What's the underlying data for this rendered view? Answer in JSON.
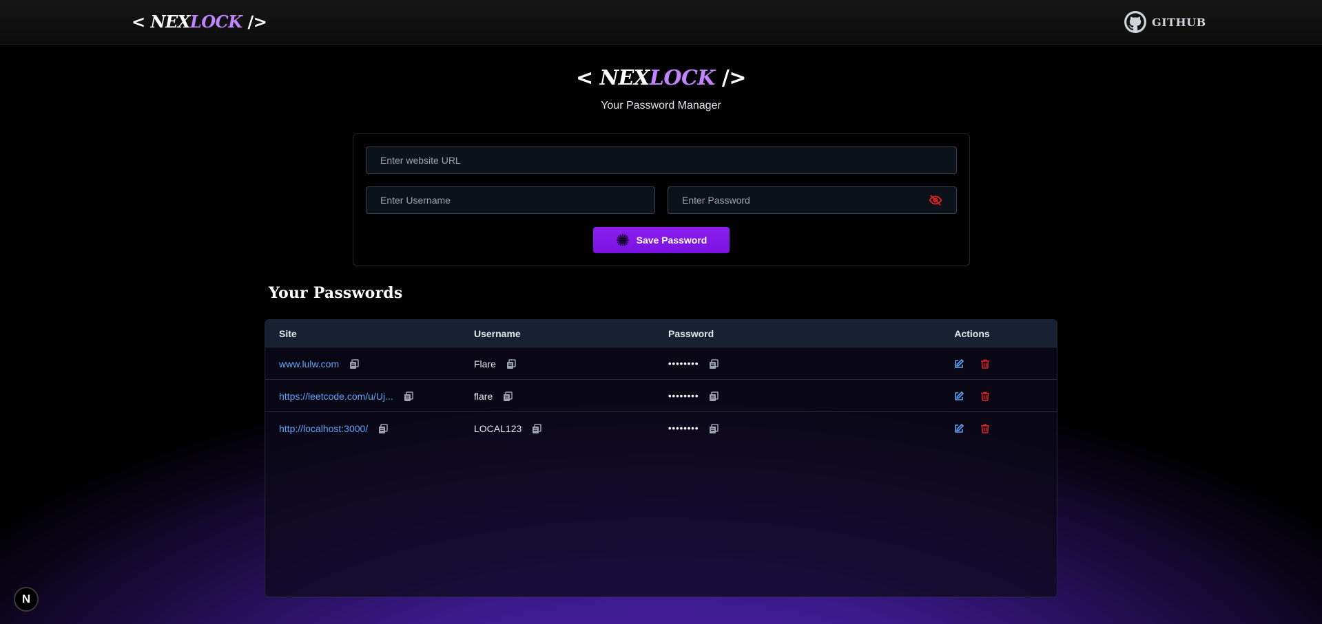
{
  "navbar": {
    "logo": {
      "open": "<",
      "part1": "NEX",
      "part2": "LOCK",
      "close": "/>"
    },
    "github_label": "GITHUB"
  },
  "header": {
    "logo": {
      "open": "<",
      "part1": "NEX",
      "part2": "LOCK",
      "close": "/>"
    },
    "subtitle": "Your Password Manager"
  },
  "form": {
    "url_placeholder": "Enter website URL",
    "url_value": "",
    "username_placeholder": "Enter Username",
    "username_value": "",
    "password_placeholder": "Enter Password",
    "password_value": "",
    "save_label": "Save Password"
  },
  "passwords": {
    "title": "Your Passwords",
    "columns": [
      "Site",
      "Username",
      "Password",
      "Actions"
    ],
    "rows": [
      {
        "site": "www.lulw.com",
        "username": "Flare",
        "password": "••••••••"
      },
      {
        "site": "https://leetcode.com/u/Uj...",
        "username": "flare",
        "password": "••••••••"
      },
      {
        "site": "http://localhost:3000/",
        "username": "LOCAL123",
        "password": "••••••••"
      }
    ]
  },
  "dev_badge": {
    "label": "N"
  },
  "colors": {
    "accent": "#7e22ce",
    "logo_accent": "#c084fc",
    "link": "#60a5fa",
    "edit_icon": "#60a5fa",
    "delete_icon": "#dc2626",
    "eye_icon": "#dc2626"
  },
  "icons": {
    "github": "github-icon",
    "eye_toggle": "eye-slash-icon",
    "save": "save-spark-icon",
    "copy": "copy-icon",
    "edit": "edit-icon",
    "delete": "trash-icon"
  }
}
